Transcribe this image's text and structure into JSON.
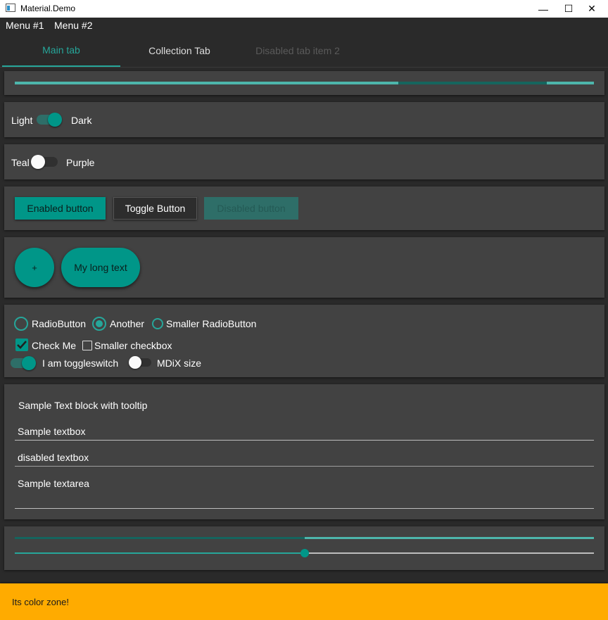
{
  "window": {
    "title": "Material.Demo",
    "minimize_glyph": "—",
    "maximize_glyph": "☐",
    "close_glyph": "✕"
  },
  "menu": {
    "items": [
      "Menu #1",
      "Menu #2"
    ]
  },
  "tabs": [
    {
      "label": "Main tab",
      "selected": true
    },
    {
      "label": "Collection Tab",
      "selected": false
    },
    {
      "label": "Disabled tab item 2",
      "disabled": true
    }
  ],
  "progress": {
    "value_fraction": 0.66,
    "secondary_start_fraction": 0.92
  },
  "theme_toggle": {
    "left_label": "Light",
    "right_label": "Dark",
    "checked": true
  },
  "color_toggle": {
    "left_label": "Teal",
    "right_label": "Purple",
    "checked": false
  },
  "buttons": {
    "enabled": "Enabled button",
    "toggle": "Toggle Button",
    "disabled": "Disabled button"
  },
  "fabs": {
    "plus": "+",
    "long": "My long text"
  },
  "radios": [
    {
      "label": "RadioButton",
      "checked": false
    },
    {
      "label": "Another",
      "checked": true
    },
    {
      "label": "Smaller RadioButton",
      "checked": false
    }
  ],
  "checkboxes": [
    {
      "label": "Check Me",
      "checked": true
    },
    {
      "label": "Smaller checkbox",
      "checked": false
    }
  ],
  "switches": [
    {
      "label": "I am toggleswitch",
      "checked": true
    },
    {
      "label": "MDiX size",
      "checked": false
    }
  ],
  "text": {
    "tooltip_block": "Sample Text block with tooltip",
    "textbox": "Sample textbox",
    "disabled_textbox": "disabled textbox",
    "textarea": "Sample textarea"
  },
  "sliders": {
    "slider1_fraction": 0.5,
    "slider2_fraction": 0.5
  },
  "color_zone": {
    "text": "Its color zone!",
    "color": "#ffab00"
  },
  "colors": {
    "accent": "#009688",
    "accent_light": "#4db6ac",
    "card": "#424242",
    "background": "#2a2a2a"
  },
  "icons": [
    "app-icon",
    "minimize-icon",
    "maximize-icon",
    "close-icon",
    "checkmark-icon"
  ]
}
